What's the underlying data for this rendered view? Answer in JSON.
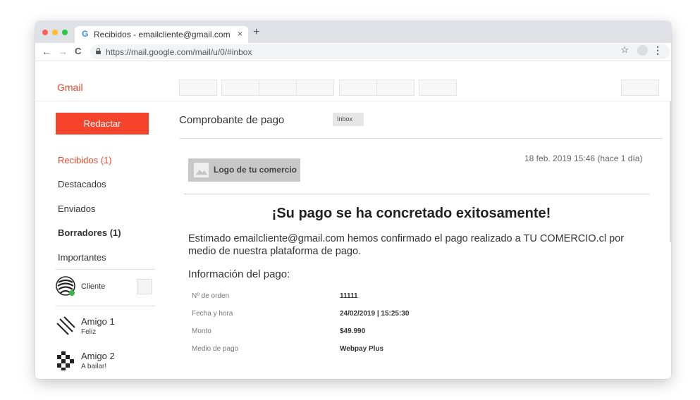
{
  "browser": {
    "tab_title": "Recibidos - emailcliente@gmail.com",
    "tab_favicon": "G",
    "tab_close": "×",
    "new_tab": "+",
    "url": "https://mail.google.com/mail/u/0/#inbox",
    "back_icon": "←",
    "forward_icon": "→",
    "reload_icon": "C",
    "star_icon": "☆",
    "menu_icon": "⋮"
  },
  "app": {
    "name": "Gmail"
  },
  "sidebar": {
    "compose_label": "Redactar",
    "folders": [
      {
        "label": "Recibidos (1)"
      },
      {
        "label": "Destacados"
      },
      {
        "label": "Enviados"
      },
      {
        "label": "Borradores (1)"
      },
      {
        "label": "Importantes"
      }
    ],
    "contacts": [
      {
        "name": "Cliente",
        "status": ""
      },
      {
        "name": "Amigo 1",
        "status": "Feliz"
      },
      {
        "name": "Amigo 2",
        "status": "A bailar!"
      }
    ]
  },
  "email": {
    "subject": "Comprobante de pago",
    "label_badge": "Inbox",
    "logo_text": "Logo de tu comercio",
    "date": "18 feb. 2019 15:46 (hace 1 día)",
    "headline": "¡Su pago se ha concretado exitosamente!",
    "body": "Estimado emailcliente@gmail.com hemos confirmado el pago realizado a TU COMERCIO.cl por medio de nuestra plataforma de pago.",
    "section_title": "Información del pago:",
    "details": [
      {
        "label": "Nº de orden",
        "value": "11111"
      },
      {
        "label": "Fecha y hora",
        "value": "24/02/2019 | 15:25:30"
      },
      {
        "label": "Monto",
        "value": "$49.990"
      },
      {
        "label": "Medio de pago",
        "value": "Webpay Plus"
      }
    ]
  },
  "colors": {
    "accent": "#f5432c",
    "gmail_red": "#e8472b",
    "traffic_red": "#ff5f57",
    "traffic_yellow": "#febc2e",
    "traffic_green": "#28c840"
  }
}
